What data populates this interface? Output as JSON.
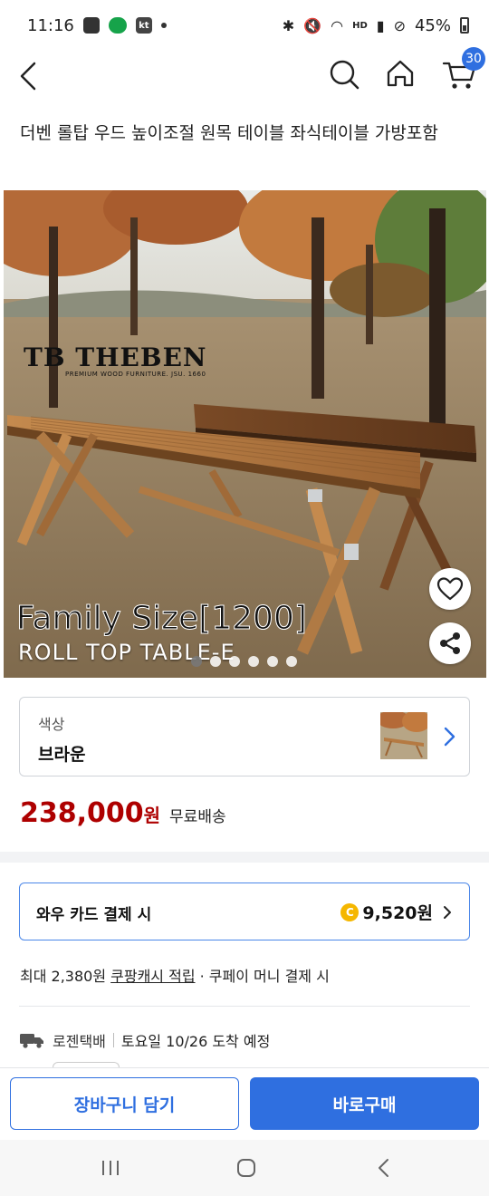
{
  "status_bar": {
    "time": "11:16",
    "battery": "45%",
    "hd_label": "HD"
  },
  "header": {
    "cart_count": "30"
  },
  "product": {
    "title": "더벤 롤탑 우드 높이조절 원목 테이블 좌식테이블 가방포함"
  },
  "hero_image": {
    "brand": "THEBEN",
    "brand_mark": "TB",
    "brand_sub": "PREMIUM WOOD FURNITURE. JSU. 1660",
    "headline": "Family Size[1200]",
    "subheadline": "ROLL TOP TABLE-E",
    "slide_count": 6,
    "active_slide": 1
  },
  "option": {
    "label": "색상",
    "value": "브라운"
  },
  "price": {
    "amount": "238,000",
    "currency": "원",
    "shipping": "무료배송"
  },
  "wow_card": {
    "label": "와우 카드 결제 시",
    "coin_symbol": "C",
    "amount": "9,520원"
  },
  "cashback": {
    "prefix": "최대 2,380원 ",
    "link": "쿠팡캐시 적립",
    "suffix": " · 쿠페이 머니 결제 시"
  },
  "delivery": {
    "company": "로젠택배",
    "eta": "토요일 10/26 도착 예정"
  },
  "actions": {
    "cart_label": "장바구니 담기",
    "buy_label": "바로구매"
  },
  "colors": {
    "primary_blue": "#2f6fe0",
    "price_red": "#ae0000",
    "coin_yellow": "#f5b700"
  }
}
